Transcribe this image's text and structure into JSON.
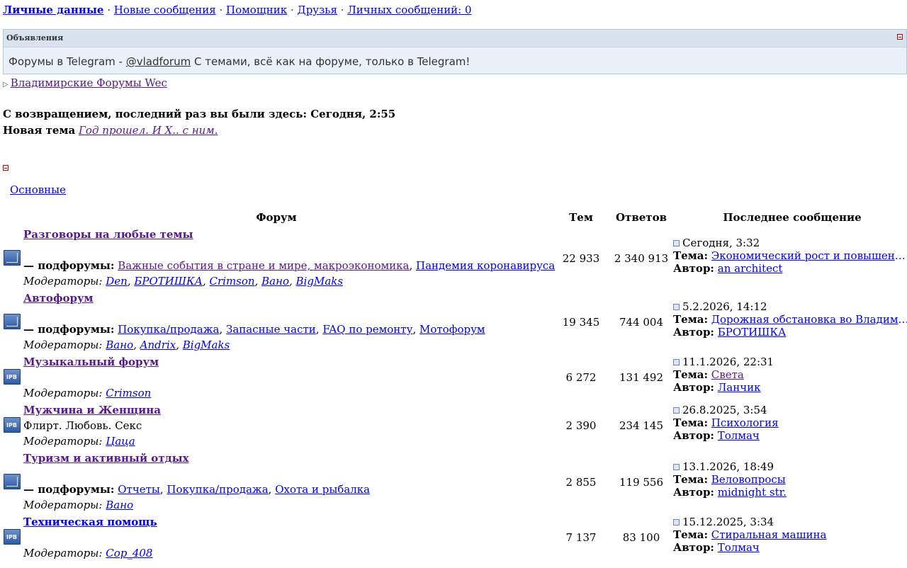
{
  "nav": {
    "personal": "Личные данные",
    "new_messages": "Новые сообщения",
    "helper": "Помощник",
    "friends": "Друзья",
    "private_messages": "Личных сообщений: 0",
    "sep": "·"
  },
  "announce": {
    "title": "Объявления",
    "text_before": "Форумы в Telegram - ",
    "link": "@vladforum",
    "text_after": " С темами, всё как на форуме, только в Telegram!"
  },
  "breadcrumb": "Владимирские Форумы Wec",
  "welcome": "С возвращением, последний раз вы были здесь: Сегодня, 2:55",
  "new_topic": {
    "label": "Новая тема",
    "link": "Год прошел. И Х.. с ним."
  },
  "category": "Основные",
  "headers": {
    "forum": "Форум",
    "topics": "Тем",
    "replies": "Ответов",
    "last": "Последнее сообщение"
  },
  "labels": {
    "subforums": "— подфорумы:",
    "moderators": "Модераторы:",
    "topic": "Тема:",
    "author": "Автор:"
  },
  "forums": [
    {
      "name": "Разговоры на любые темы",
      "subforums": [
        "Важные события в стране и мире, макроэкономика",
        "Пандемия коронавируса"
      ],
      "moderators": [
        "Den",
        "БРОТИШКА",
        "Crimson",
        "Вано",
        "BigMaks"
      ],
      "topics": "22 933",
      "replies": "2 340 913",
      "last_date": "Сегодня, 3:32",
      "last_topic": "Экономический рост и повышение...",
      "last_author": "an architect"
    },
    {
      "name": "Автофорум",
      "subforums": [
        "Покупка/продажа",
        "Запасные части",
        "FAQ по ремонту",
        "Мотофорум"
      ],
      "moderators": [
        "Вано",
        "Andrix",
        "BigMaks"
      ],
      "topics": "19 345",
      "replies": "744 004",
      "last_date": "5.2.2026, 14:12",
      "last_topic": "Дорожная обстановка во Владими...",
      "last_author": "БРОТИШКА"
    },
    {
      "name": "Музыкальный форум",
      "moderators": [
        "Crimson"
      ],
      "topics": "6 272",
      "replies": "131 492",
      "last_date": "11.1.2026, 22:31",
      "last_topic": "Света",
      "last_author": "Ланчик"
    },
    {
      "name": "Мужчина и Женщина",
      "description": "Флирт. Любовь. Секс",
      "moderators": [
        "Цаца"
      ],
      "topics": "2 390",
      "replies": "234 145",
      "last_date": "26.8.2025, 3:54",
      "last_topic": "Психология",
      "last_author": "Толмач"
    },
    {
      "name": "Туризм и активный отдых",
      "subforums": [
        "Отчеты",
        "Покупка/продажа",
        "Охота и рыбалка"
      ],
      "moderators": [
        "Вано"
      ],
      "topics": "2 855",
      "replies": "119 556",
      "last_date": "13.1.2026, 18:49",
      "last_topic": "Веловопросы",
      "last_author": "midnight str."
    },
    {
      "name": "Техническая помощь",
      "moderators": [
        "Cop_408"
      ],
      "topics": "7 137",
      "replies": "83 100",
      "last_date": "15.12.2025, 3:34",
      "last_topic": "Стиральная машина",
      "last_author": "Толмач"
    }
  ],
  "icon_label": "IPB"
}
